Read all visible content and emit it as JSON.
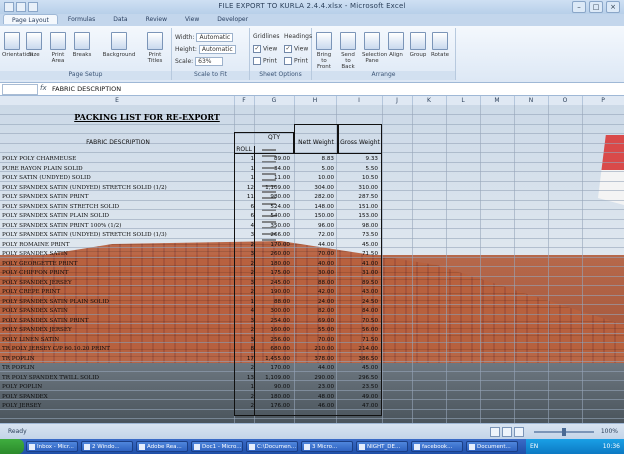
{
  "window": {
    "title": "FILE EXPORT TO KURLA 2.4.4.xlsx - Microsoft Excel",
    "controls": [
      "–",
      "□",
      "×"
    ]
  },
  "tabs": [
    "Page Layout",
    "Formulas",
    "Data",
    "Review",
    "View",
    "Developer"
  ],
  "ribbon": {
    "page_setup": {
      "label": "Page Setup",
      "buttons": [
        "Print Area",
        "Breaks",
        "Background",
        "Print Titles"
      ],
      "first_buttons": [
        "Orientation",
        "Size"
      ]
    },
    "scale_to_fit": {
      "label": "Scale to Fit",
      "width_label": "Width:",
      "width_value": "Automatic",
      "height_label": "Height:",
      "height_value": "Automatic",
      "scale_label": "Scale:",
      "scale_value": "63%"
    },
    "sheet_options": {
      "label": "Sheet Options",
      "gridlines": "Gridlines",
      "headings": "Headings",
      "view": "View",
      "print": "Print"
    },
    "arrange": {
      "label": "Arrange",
      "buttons": [
        "Bring to Front",
        "Send to Back",
        "Selection Pane",
        "Align",
        "Group",
        "Rotate"
      ]
    }
  },
  "formula_bar": {
    "fx": "fx",
    "content": "FABRIC DESCRIPTION"
  },
  "columns": [
    "E",
    "F",
    "G",
    "H",
    "I",
    "J",
    "K",
    "L",
    "M",
    "N",
    "O",
    "P"
  ],
  "sheet": {
    "title": "PACKING LIST FOR RE-EXPORT",
    "headers": {
      "description": "FABRIC DESCRIPTION",
      "qty": "QTY",
      "roll": "ROLL",
      "net": "Nett Weight",
      "gross": "Gross Weight"
    },
    "rows": [
      {
        "desc": "POLY POLY CHARMEUSE",
        "roll": "1",
        "qty": "89.00",
        "net": "8.83",
        "gross": "9.33"
      },
      {
        "desc": "PURE RAYON PLAIN SOLID",
        "roll": "1",
        "qty": "34.00",
        "net": "5.00",
        "gross": "5.50"
      },
      {
        "desc": "POLY SATIN (UNDYED) SOLID",
        "roll": "1",
        "qty": "11.00",
        "net": "10.00",
        "gross": "10.50"
      },
      {
        "desc": "POLY SPANDEX SATIN (UNDYED) STRETCH SOLID (1/2)",
        "roll": "12",
        "qty": "1,109.00",
        "net": "304.00",
        "gross": "310.00"
      },
      {
        "desc": "POLY SPANDEX SATIN PRINT",
        "roll": "11",
        "qty": "980.00",
        "net": "282.00",
        "gross": "287.50"
      },
      {
        "desc": "POLY SPANDEX SATIN STRETCH SOLID",
        "roll": "6",
        "qty": "524.00",
        "net": "148.00",
        "gross": "151.00"
      },
      {
        "desc": "POLY SPANDEX SATIN PLAIN SOLID",
        "roll": "6",
        "qty": "540.00",
        "net": "150.00",
        "gross": "153.00"
      },
      {
        "desc": "POLY SPANDEX SATIN PRINT 100% (1/2)",
        "roll": "4",
        "qty": "350.00",
        "net": "96.00",
        "gross": "98.00"
      },
      {
        "desc": "POLY SPANDEX SATIN (UNDYED) STRETCH SOLID (1/3)",
        "roll": "3",
        "qty": "266.00",
        "net": "72.00",
        "gross": "73.50"
      },
      {
        "desc": "POLY ROMAINE PRINT",
        "roll": "2",
        "qty": "170.00",
        "net": "44.00",
        "gross": "45.00"
      },
      {
        "desc": "POLY SPANDEX SATIN",
        "roll": "3",
        "qty": "260.00",
        "net": "70.00",
        "gross": "71.50"
      },
      {
        "desc": "POLY GEORGETTE PRINT",
        "roll": "2",
        "qty": "180.00",
        "net": "40.00",
        "gross": "41.00"
      },
      {
        "desc": "POLY CHIFFON PRINT",
        "roll": "2",
        "qty": "175.00",
        "net": "30.00",
        "gross": "31.00"
      },
      {
        "desc": "POLY SPANDEX JERSEY",
        "roll": "3",
        "qty": "245.00",
        "net": "88.00",
        "gross": "89.50"
      },
      {
        "desc": "POLY CREPE PRINT",
        "roll": "2",
        "qty": "190.00",
        "net": "42.00",
        "gross": "43.00"
      },
      {
        "desc": "POLY SPANDEX SATIN PLAIN SOLID",
        "roll": "1",
        "qty": "88.00",
        "net": "24.00",
        "gross": "24.50"
      },
      {
        "desc": "POLY SPANDEX SATIN",
        "roll": "4",
        "qty": "300.00",
        "net": "82.00",
        "gross": "84.00"
      },
      {
        "desc": "POLY SPANDEX SATIN PRINT",
        "roll": "3",
        "qty": "254.00",
        "net": "69.00",
        "gross": "70.50"
      },
      {
        "desc": "POLY SPANDEX JERSEY",
        "roll": "2",
        "qty": "160.00",
        "net": "55.00",
        "gross": "56.00"
      },
      {
        "desc": "POLY LINEN SATIN",
        "roll": "3",
        "qty": "256.00",
        "net": "70.00",
        "gross": "71.50"
      },
      {
        "desc": "TR POLY JERSEY C/P 60.10.20 PRINT",
        "roll": "8",
        "qty": "680.00",
        "net": "210.00",
        "gross": "214.00"
      },
      {
        "desc": "TR POPLIN",
        "roll": "17",
        "qty": "1,455.00",
        "net": "378.00",
        "gross": "386.50"
      },
      {
        "desc": "TR POPLIN",
        "roll": "2",
        "qty": "170.00",
        "net": "44.00",
        "gross": "45.00"
      },
      {
        "desc": "TR POLY SPANDEX TWILL SOLID",
        "roll": "13",
        "qty": "1,109.00",
        "net": "290.00",
        "gross": "296.50"
      },
      {
        "desc": "POLY POPLIN",
        "roll": "1",
        "qty": "90.00",
        "net": "23.00",
        "gross": "23.50"
      },
      {
        "desc": "POLY SPANDEX",
        "roll": "2",
        "qty": "180.00",
        "net": "48.00",
        "gross": "49.00"
      },
      {
        "desc": "POLY JERSEY",
        "roll": "2",
        "qty": "176.00",
        "net": "46.00",
        "gross": "47.00"
      }
    ]
  },
  "status": {
    "ready": "Ready",
    "zoom": "100%"
  },
  "taskbar": {
    "tasks": [
      "Inbox - Micr...",
      "2 Windo...",
      "Adobe Rea...",
      "Doc1 - Micro...",
      "C:\\Documen...",
      "3 Micro...",
      "NIGHT_DE...",
      "facebook...",
      "Document..."
    ],
    "lang": "EN",
    "clock": "10:36"
  }
}
